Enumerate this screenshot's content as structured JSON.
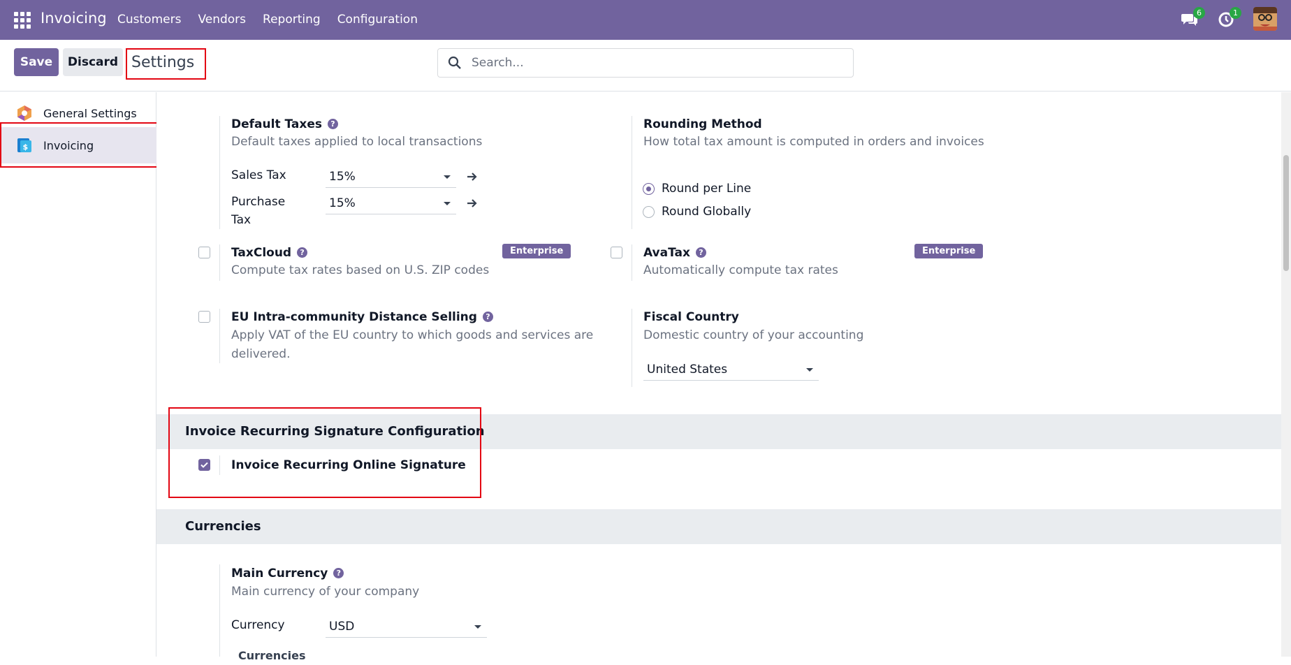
{
  "navbar": {
    "app_title": "Invoicing",
    "menu": [
      "Customers",
      "Vendors",
      "Reporting",
      "Configuration"
    ],
    "messages_count": "6",
    "activities_count": "1",
    "bg_color": "#71639e"
  },
  "control": {
    "save_label": "Save",
    "discard_label": "Discard",
    "breadcrumb": "Settings",
    "search_placeholder": "Search..."
  },
  "sidebar": {
    "items": [
      {
        "label": "General Settings",
        "icon": "odoo-settings-icon"
      },
      {
        "label": "Invoicing",
        "icon": "invoicing-app-icon"
      }
    ]
  },
  "taxes": {
    "default_taxes": {
      "title": "Default Taxes",
      "desc": "Default taxes applied to local transactions",
      "sales_label": "Sales Tax",
      "sales_value": "15%",
      "purchase_label_1": "Purchase",
      "purchase_label_2": "Tax",
      "purchase_value": "15%"
    },
    "rounding": {
      "title": "Rounding Method",
      "desc": "How total tax amount is computed in orders and invoices",
      "options": [
        "Round per Line",
        "Round Globally"
      ],
      "selected": "Round per Line"
    },
    "taxcloud": {
      "title": "TaxCloud",
      "desc": "Compute tax rates based on U.S. ZIP codes",
      "badge": "Enterprise",
      "checked": false
    },
    "avatax": {
      "title": "AvaTax",
      "desc": "Automatically compute tax rates",
      "badge": "Enterprise",
      "checked": false
    },
    "eu": {
      "title": "EU Intra-community Distance Selling",
      "desc_1": "Apply VAT of the EU country to which goods and services are",
      "desc_2": "delivered.",
      "checked": false
    },
    "fiscal": {
      "title": "Fiscal Country",
      "desc": "Domestic country of your accounting",
      "value": "United States"
    }
  },
  "signature_section": {
    "header": "Invoice Recurring Signature Configuration",
    "option": "Invoice Recurring Online Signature",
    "checked": true
  },
  "currencies_section": {
    "header": "Currencies",
    "main_currency_title": "Main Currency",
    "main_currency_desc": "Main currency of your company",
    "currency_label": "Currency",
    "currency_value": "USD",
    "currencies_link": "Currencies"
  }
}
